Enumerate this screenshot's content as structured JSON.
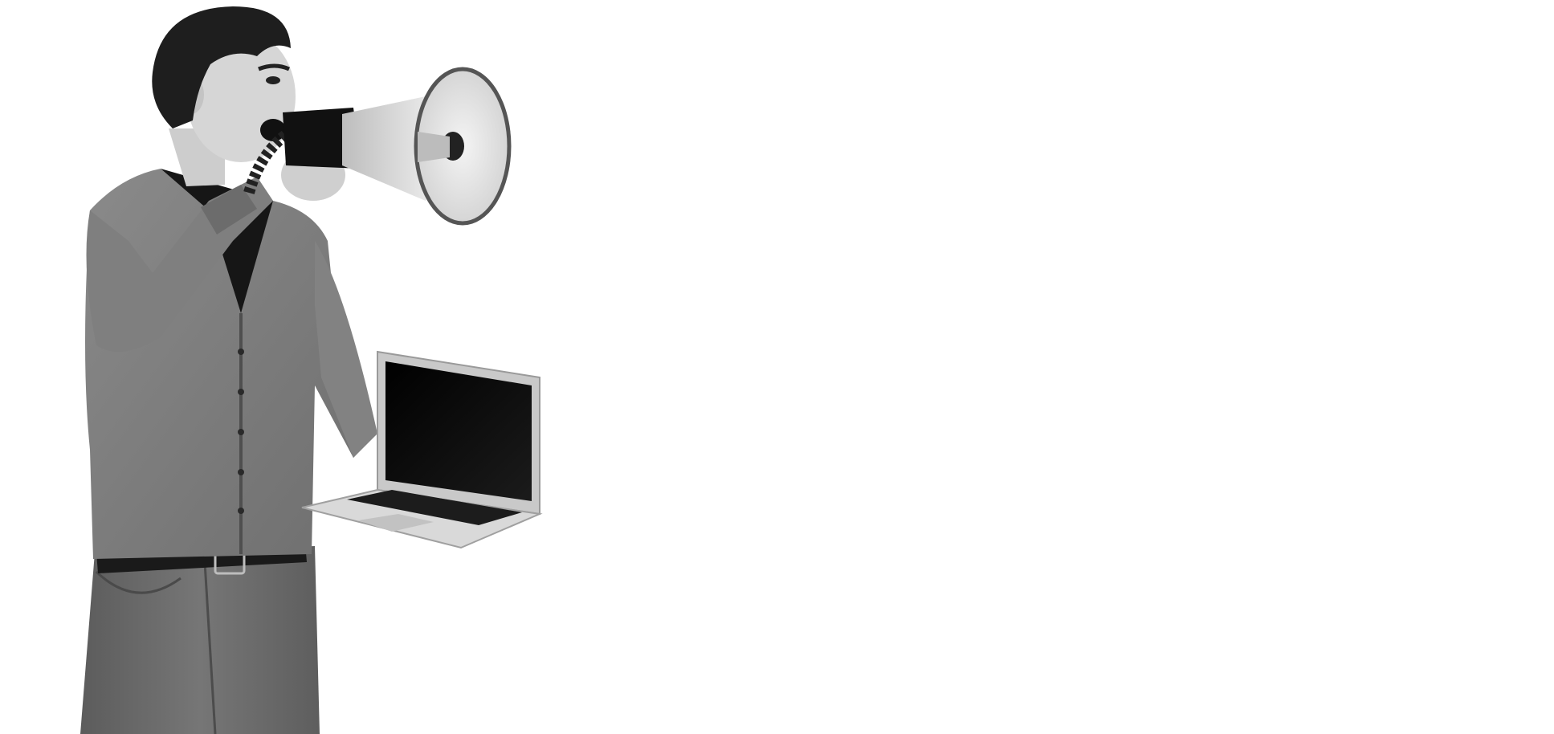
{
  "colors": {
    "background": "#ffffff",
    "skin": "#d6d6d6",
    "hair": "#1e1e1e",
    "cardigan": "#7d7d7d",
    "undershirt": "#161616",
    "jeans": "#6a6a6a",
    "belt": "#1a1a1a",
    "megaphone_body": "#e4e4e4",
    "megaphone_dark": "#111111",
    "laptop_shell": "#cfcfcf",
    "laptop_screen": "#0a0a0a",
    "keyboard": "#1c1c1c"
  },
  "icons": [
    "person",
    "megaphone",
    "laptop"
  ]
}
